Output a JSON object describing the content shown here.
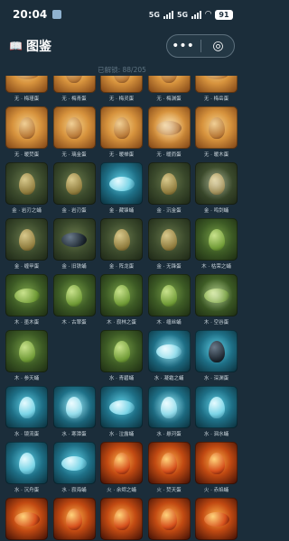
{
  "status": {
    "time": "20:04",
    "signal_1": "5G",
    "signal_2": "5G",
    "battery": "91"
  },
  "header": {
    "title": "图鉴",
    "title_icon": "book-icon",
    "menu_icon": "more-dots-icon",
    "close_icon": "capsule-close-icon"
  },
  "collection": {
    "progress": "已解锁: 88/205"
  },
  "theme_colors": {
    "background": "#1b2d3a",
    "none": "#d7933d",
    "gold": "#8e7b3d",
    "wood": "#6f9a36",
    "water": "#1e6f86",
    "fire": "#c24a12"
  },
  "items": [
    {
      "name": "无 · 梅瑾蛋",
      "element": "none"
    },
    {
      "name": "无 · 梅青蛋",
      "element": "none"
    },
    {
      "name": "无 · 梅灵蛋",
      "element": "none"
    },
    {
      "name": "无 · 梅渊蛋",
      "element": "none"
    },
    {
      "name": "无 · 梅岳蛋",
      "element": "none"
    },
    {
      "name": "无 · 暖焚蛋",
      "element": "none"
    },
    {
      "name": "无 · 璃金蛋",
      "element": "none"
    },
    {
      "name": "无 · 暖禅蛋",
      "element": "none"
    },
    {
      "name": "无 · 暖而蛋",
      "element": "none",
      "glow": true
    },
    {
      "name": "无 · 暖木蛋",
      "element": "none"
    },
    {
      "name": "金 · 岩刃之蛹",
      "element": "gold"
    },
    {
      "name": "金 · 岩刃蛋",
      "element": "gold"
    },
    {
      "name": "金 · 藏锋蛹",
      "element": "water"
    },
    {
      "name": "金 · 沉金蛋",
      "element": "gold"
    },
    {
      "name": "金 · 鸣剑蛹",
      "element": "gold",
      "glow": true
    },
    {
      "name": "金 · 缠甲蛋",
      "element": "gold"
    },
    {
      "name": "金 · 旧铁蛹",
      "element": "gold",
      "dark": true
    },
    {
      "name": "金 · 阵龙蛋",
      "element": "gold"
    },
    {
      "name": "金 · 无锋蛋",
      "element": "gold"
    },
    {
      "name": "木 · 枯荣之蛹",
      "element": "wood"
    },
    {
      "name": "木 · 墨木蛋",
      "element": "wood"
    },
    {
      "name": "木 · 古翠蛋",
      "element": "wood"
    },
    {
      "name": "木 · 寂林之蛋",
      "element": "wood"
    },
    {
      "name": "木 · 缠丝蛹",
      "element": "wood"
    },
    {
      "name": "木 · 空谷蛋",
      "element": "wood",
      "glow": true
    },
    {
      "name": "木 · 参天蛹",
      "element": "wood"
    },
    {
      "name": "",
      "element": "empty"
    },
    {
      "name": "水 · 青碧蛹",
      "element": "wood"
    },
    {
      "name": "水 · 凝霜之蛹",
      "element": "water",
      "glow": true
    },
    {
      "name": "水 · 深渊蛋",
      "element": "water",
      "dark": true
    },
    {
      "name": "水 · 镜流蛋",
      "element": "water"
    },
    {
      "name": "水 · 寒潭蛋",
      "element": "water",
      "glow": true
    },
    {
      "name": "水 · 泣露蛹",
      "element": "water"
    },
    {
      "name": "水 · 悬河蛋",
      "element": "water",
      "glow": true
    },
    {
      "name": "水 · 洄水蛹",
      "element": "water"
    },
    {
      "name": "水 · 沉舟蛋",
      "element": "water"
    },
    {
      "name": "水 · 寂海蛹",
      "element": "water"
    },
    {
      "name": "火 · 余烬之蛹",
      "element": "fire"
    },
    {
      "name": "火 · 焚天蛋",
      "element": "fire"
    },
    {
      "name": "火 · 赤焰蛹",
      "element": "fire"
    },
    {
      "name": "",
      "element": "fire"
    },
    {
      "name": "",
      "element": "fire"
    },
    {
      "name": "",
      "element": "fire"
    },
    {
      "name": "",
      "element": "fire"
    },
    {
      "name": "",
      "element": "fire"
    }
  ]
}
